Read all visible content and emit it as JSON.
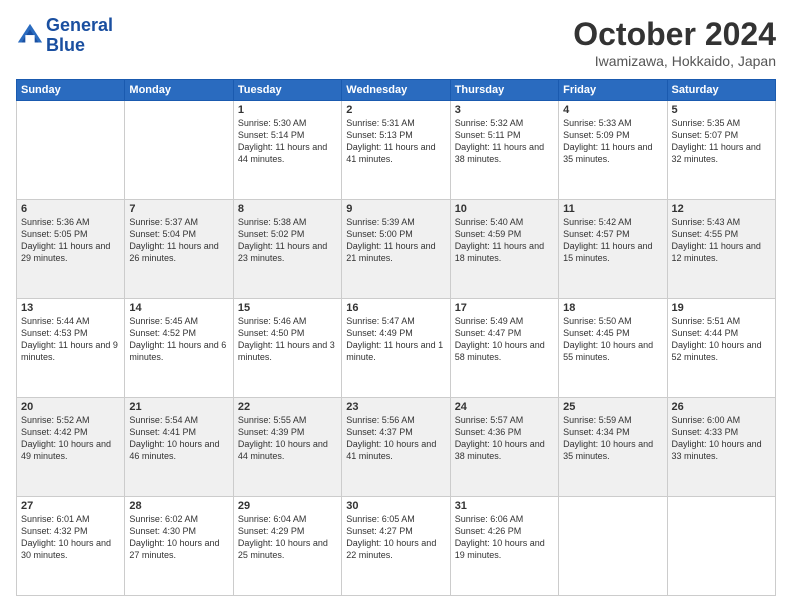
{
  "header": {
    "logo_line1": "General",
    "logo_line2": "Blue",
    "month": "October 2024",
    "location": "Iwamizawa, Hokkaido, Japan"
  },
  "days_of_week": [
    "Sunday",
    "Monday",
    "Tuesday",
    "Wednesday",
    "Thursday",
    "Friday",
    "Saturday"
  ],
  "weeks": [
    [
      {
        "day": "",
        "info": ""
      },
      {
        "day": "",
        "info": ""
      },
      {
        "day": "1",
        "info": "Sunrise: 5:30 AM\nSunset: 5:14 PM\nDaylight: 11 hours and 44 minutes."
      },
      {
        "day": "2",
        "info": "Sunrise: 5:31 AM\nSunset: 5:13 PM\nDaylight: 11 hours and 41 minutes."
      },
      {
        "day": "3",
        "info": "Sunrise: 5:32 AM\nSunset: 5:11 PM\nDaylight: 11 hours and 38 minutes."
      },
      {
        "day": "4",
        "info": "Sunrise: 5:33 AM\nSunset: 5:09 PM\nDaylight: 11 hours and 35 minutes."
      },
      {
        "day": "5",
        "info": "Sunrise: 5:35 AM\nSunset: 5:07 PM\nDaylight: 11 hours and 32 minutes."
      }
    ],
    [
      {
        "day": "6",
        "info": "Sunrise: 5:36 AM\nSunset: 5:05 PM\nDaylight: 11 hours and 29 minutes."
      },
      {
        "day": "7",
        "info": "Sunrise: 5:37 AM\nSunset: 5:04 PM\nDaylight: 11 hours and 26 minutes."
      },
      {
        "day": "8",
        "info": "Sunrise: 5:38 AM\nSunset: 5:02 PM\nDaylight: 11 hours and 23 minutes."
      },
      {
        "day": "9",
        "info": "Sunrise: 5:39 AM\nSunset: 5:00 PM\nDaylight: 11 hours and 21 minutes."
      },
      {
        "day": "10",
        "info": "Sunrise: 5:40 AM\nSunset: 4:59 PM\nDaylight: 11 hours and 18 minutes."
      },
      {
        "day": "11",
        "info": "Sunrise: 5:42 AM\nSunset: 4:57 PM\nDaylight: 11 hours and 15 minutes."
      },
      {
        "day": "12",
        "info": "Sunrise: 5:43 AM\nSunset: 4:55 PM\nDaylight: 11 hours and 12 minutes."
      }
    ],
    [
      {
        "day": "13",
        "info": "Sunrise: 5:44 AM\nSunset: 4:53 PM\nDaylight: 11 hours and 9 minutes."
      },
      {
        "day": "14",
        "info": "Sunrise: 5:45 AM\nSunset: 4:52 PM\nDaylight: 11 hours and 6 minutes."
      },
      {
        "day": "15",
        "info": "Sunrise: 5:46 AM\nSunset: 4:50 PM\nDaylight: 11 hours and 3 minutes."
      },
      {
        "day": "16",
        "info": "Sunrise: 5:47 AM\nSunset: 4:49 PM\nDaylight: 11 hours and 1 minute."
      },
      {
        "day": "17",
        "info": "Sunrise: 5:49 AM\nSunset: 4:47 PM\nDaylight: 10 hours and 58 minutes."
      },
      {
        "day": "18",
        "info": "Sunrise: 5:50 AM\nSunset: 4:45 PM\nDaylight: 10 hours and 55 minutes."
      },
      {
        "day": "19",
        "info": "Sunrise: 5:51 AM\nSunset: 4:44 PM\nDaylight: 10 hours and 52 minutes."
      }
    ],
    [
      {
        "day": "20",
        "info": "Sunrise: 5:52 AM\nSunset: 4:42 PM\nDaylight: 10 hours and 49 minutes."
      },
      {
        "day": "21",
        "info": "Sunrise: 5:54 AM\nSunset: 4:41 PM\nDaylight: 10 hours and 46 minutes."
      },
      {
        "day": "22",
        "info": "Sunrise: 5:55 AM\nSunset: 4:39 PM\nDaylight: 10 hours and 44 minutes."
      },
      {
        "day": "23",
        "info": "Sunrise: 5:56 AM\nSunset: 4:37 PM\nDaylight: 10 hours and 41 minutes."
      },
      {
        "day": "24",
        "info": "Sunrise: 5:57 AM\nSunset: 4:36 PM\nDaylight: 10 hours and 38 minutes."
      },
      {
        "day": "25",
        "info": "Sunrise: 5:59 AM\nSunset: 4:34 PM\nDaylight: 10 hours and 35 minutes."
      },
      {
        "day": "26",
        "info": "Sunrise: 6:00 AM\nSunset: 4:33 PM\nDaylight: 10 hours and 33 minutes."
      }
    ],
    [
      {
        "day": "27",
        "info": "Sunrise: 6:01 AM\nSunset: 4:32 PM\nDaylight: 10 hours and 30 minutes."
      },
      {
        "day": "28",
        "info": "Sunrise: 6:02 AM\nSunset: 4:30 PM\nDaylight: 10 hours and 27 minutes."
      },
      {
        "day": "29",
        "info": "Sunrise: 6:04 AM\nSunset: 4:29 PM\nDaylight: 10 hours and 25 minutes."
      },
      {
        "day": "30",
        "info": "Sunrise: 6:05 AM\nSunset: 4:27 PM\nDaylight: 10 hours and 22 minutes."
      },
      {
        "day": "31",
        "info": "Sunrise: 6:06 AM\nSunset: 4:26 PM\nDaylight: 10 hours and 19 minutes."
      },
      {
        "day": "",
        "info": ""
      },
      {
        "day": "",
        "info": ""
      }
    ]
  ]
}
